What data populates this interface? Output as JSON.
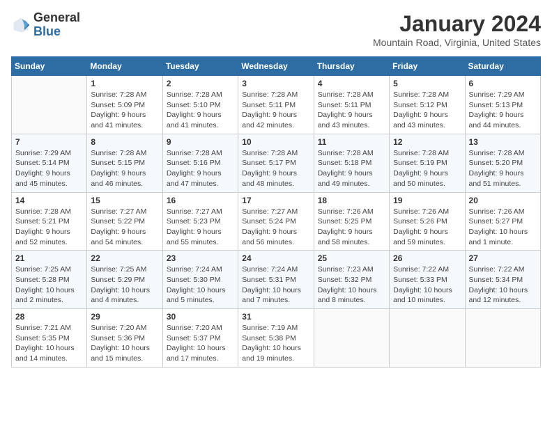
{
  "header": {
    "logo_general": "General",
    "logo_blue": "Blue",
    "month_title": "January 2024",
    "location": "Mountain Road, Virginia, United States"
  },
  "calendar": {
    "headers": [
      "Sunday",
      "Monday",
      "Tuesday",
      "Wednesday",
      "Thursday",
      "Friday",
      "Saturday"
    ],
    "weeks": [
      [
        {
          "day": "",
          "info": ""
        },
        {
          "day": "1",
          "info": "Sunrise: 7:28 AM\nSunset: 5:09 PM\nDaylight: 9 hours\nand 41 minutes."
        },
        {
          "day": "2",
          "info": "Sunrise: 7:28 AM\nSunset: 5:10 PM\nDaylight: 9 hours\nand 41 minutes."
        },
        {
          "day": "3",
          "info": "Sunrise: 7:28 AM\nSunset: 5:11 PM\nDaylight: 9 hours\nand 42 minutes."
        },
        {
          "day": "4",
          "info": "Sunrise: 7:28 AM\nSunset: 5:11 PM\nDaylight: 9 hours\nand 43 minutes."
        },
        {
          "day": "5",
          "info": "Sunrise: 7:28 AM\nSunset: 5:12 PM\nDaylight: 9 hours\nand 43 minutes."
        },
        {
          "day": "6",
          "info": "Sunrise: 7:29 AM\nSunset: 5:13 PM\nDaylight: 9 hours\nand 44 minutes."
        }
      ],
      [
        {
          "day": "7",
          "info": "Sunrise: 7:29 AM\nSunset: 5:14 PM\nDaylight: 9 hours\nand 45 minutes."
        },
        {
          "day": "8",
          "info": "Sunrise: 7:28 AM\nSunset: 5:15 PM\nDaylight: 9 hours\nand 46 minutes."
        },
        {
          "day": "9",
          "info": "Sunrise: 7:28 AM\nSunset: 5:16 PM\nDaylight: 9 hours\nand 47 minutes."
        },
        {
          "day": "10",
          "info": "Sunrise: 7:28 AM\nSunset: 5:17 PM\nDaylight: 9 hours\nand 48 minutes."
        },
        {
          "day": "11",
          "info": "Sunrise: 7:28 AM\nSunset: 5:18 PM\nDaylight: 9 hours\nand 49 minutes."
        },
        {
          "day": "12",
          "info": "Sunrise: 7:28 AM\nSunset: 5:19 PM\nDaylight: 9 hours\nand 50 minutes."
        },
        {
          "day": "13",
          "info": "Sunrise: 7:28 AM\nSunset: 5:20 PM\nDaylight: 9 hours\nand 51 minutes."
        }
      ],
      [
        {
          "day": "14",
          "info": "Sunrise: 7:28 AM\nSunset: 5:21 PM\nDaylight: 9 hours\nand 52 minutes."
        },
        {
          "day": "15",
          "info": "Sunrise: 7:27 AM\nSunset: 5:22 PM\nDaylight: 9 hours\nand 54 minutes."
        },
        {
          "day": "16",
          "info": "Sunrise: 7:27 AM\nSunset: 5:23 PM\nDaylight: 9 hours\nand 55 minutes."
        },
        {
          "day": "17",
          "info": "Sunrise: 7:27 AM\nSunset: 5:24 PM\nDaylight: 9 hours\nand 56 minutes."
        },
        {
          "day": "18",
          "info": "Sunrise: 7:26 AM\nSunset: 5:25 PM\nDaylight: 9 hours\nand 58 minutes."
        },
        {
          "day": "19",
          "info": "Sunrise: 7:26 AM\nSunset: 5:26 PM\nDaylight: 9 hours\nand 59 minutes."
        },
        {
          "day": "20",
          "info": "Sunrise: 7:26 AM\nSunset: 5:27 PM\nDaylight: 10 hours\nand 1 minute."
        }
      ],
      [
        {
          "day": "21",
          "info": "Sunrise: 7:25 AM\nSunset: 5:28 PM\nDaylight: 10 hours\nand 2 minutes."
        },
        {
          "day": "22",
          "info": "Sunrise: 7:25 AM\nSunset: 5:29 PM\nDaylight: 10 hours\nand 4 minutes."
        },
        {
          "day": "23",
          "info": "Sunrise: 7:24 AM\nSunset: 5:30 PM\nDaylight: 10 hours\nand 5 minutes."
        },
        {
          "day": "24",
          "info": "Sunrise: 7:24 AM\nSunset: 5:31 PM\nDaylight: 10 hours\nand 7 minutes."
        },
        {
          "day": "25",
          "info": "Sunrise: 7:23 AM\nSunset: 5:32 PM\nDaylight: 10 hours\nand 8 minutes."
        },
        {
          "day": "26",
          "info": "Sunrise: 7:22 AM\nSunset: 5:33 PM\nDaylight: 10 hours\nand 10 minutes."
        },
        {
          "day": "27",
          "info": "Sunrise: 7:22 AM\nSunset: 5:34 PM\nDaylight: 10 hours\nand 12 minutes."
        }
      ],
      [
        {
          "day": "28",
          "info": "Sunrise: 7:21 AM\nSunset: 5:35 PM\nDaylight: 10 hours\nand 14 minutes."
        },
        {
          "day": "29",
          "info": "Sunrise: 7:20 AM\nSunset: 5:36 PM\nDaylight: 10 hours\nand 15 minutes."
        },
        {
          "day": "30",
          "info": "Sunrise: 7:20 AM\nSunset: 5:37 PM\nDaylight: 10 hours\nand 17 minutes."
        },
        {
          "day": "31",
          "info": "Sunrise: 7:19 AM\nSunset: 5:38 PM\nDaylight: 10 hours\nand 19 minutes."
        },
        {
          "day": "",
          "info": ""
        },
        {
          "day": "",
          "info": ""
        },
        {
          "day": "",
          "info": ""
        }
      ]
    ]
  }
}
